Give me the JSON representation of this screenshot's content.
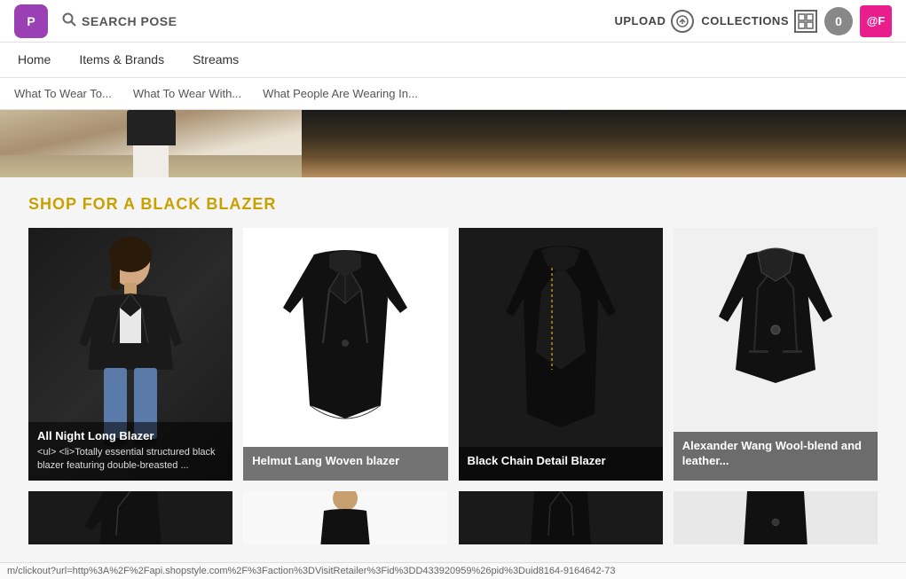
{
  "header": {
    "logo_text": "P",
    "search_label": "SEARCH POSE",
    "upload_label": "UPLOAD",
    "collections_label": "COLLECTIONS",
    "badge_count": "0",
    "at_label": "@F"
  },
  "nav": {
    "items": [
      {
        "label": "Home"
      },
      {
        "label": "Items & Brands"
      },
      {
        "label": "Streams"
      }
    ]
  },
  "sub_nav": {
    "items": [
      {
        "label": "What To Wear To..."
      },
      {
        "label": "What To Wear With..."
      },
      {
        "label": "What People Are Wearing In..."
      }
    ]
  },
  "shop_section": {
    "title": "SHOP FOR A BLACK BLAZER",
    "products": [
      {
        "name": "All Night Long Blazer",
        "desc": "<ul> <li>Totally essential structured black blazer featuring double-breasted ..."
      },
      {
        "name": "Helmut Lang Woven blazer",
        "desc": ""
      },
      {
        "name": "Black Chain Detail Blazer",
        "desc": ""
      },
      {
        "name": "Alexander Wang Wool-blend and leather...",
        "desc": ""
      }
    ]
  },
  "status_bar": {
    "url": "m/clickout?url=http%3A%2F%2Fapi.shopstyle.com%2F%3Faction%3DVisitRetailer%3Fid%3DD433920959%26pid%3Duid8164-9164642-73"
  }
}
